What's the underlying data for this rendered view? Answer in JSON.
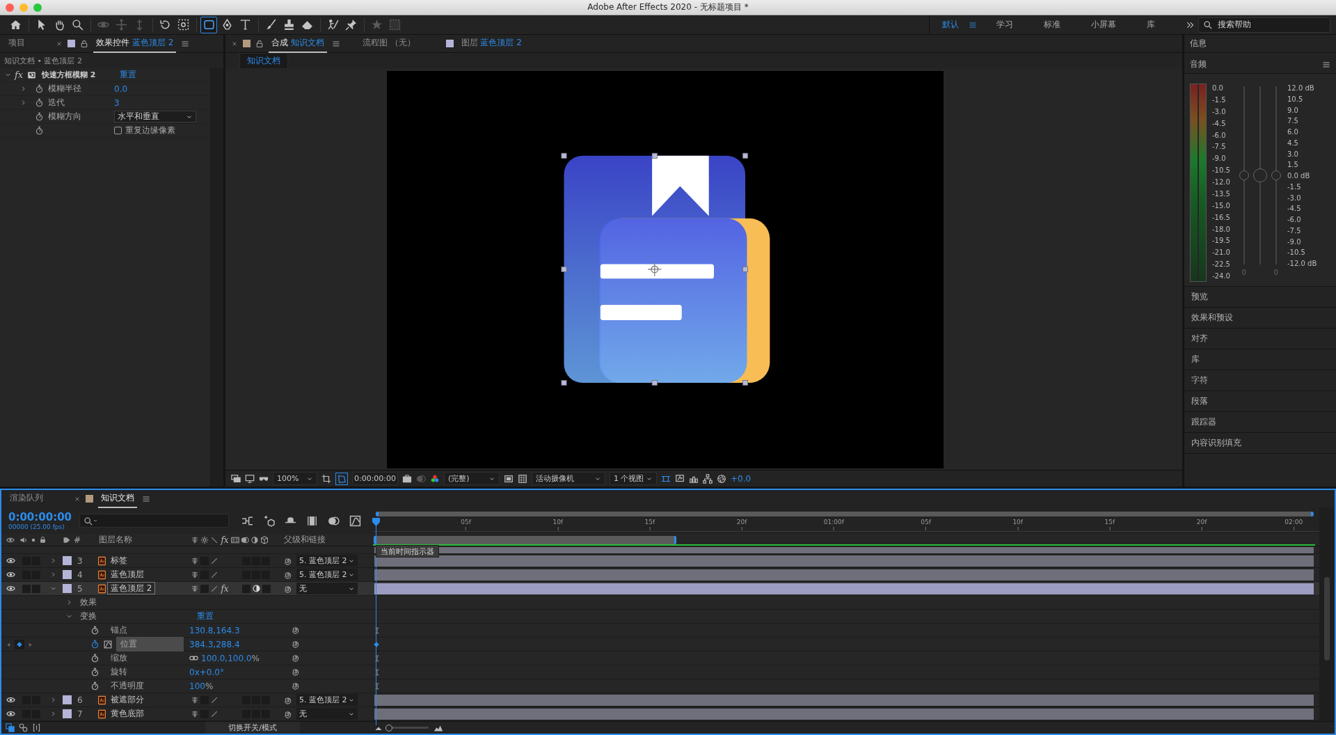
{
  "window": {
    "title": "Adobe After Effects 2020 - 无标题项目 *"
  },
  "toolbar": {
    "tools": [
      {
        "kind": "home",
        "selected": false,
        "disabled": false
      },
      {
        "kind": "select",
        "selected": false,
        "disabled": false
      },
      {
        "kind": "hand",
        "selected": false,
        "disabled": false
      },
      {
        "kind": "zoom",
        "selected": false,
        "disabled": false
      },
      {
        "kind": "orbit",
        "selected": false,
        "disabled": true
      },
      {
        "kind": "pan",
        "selected": false,
        "disabled": true
      },
      {
        "kind": "dolly",
        "selected": false,
        "disabled": true
      },
      {
        "kind": "rotate",
        "selected": false,
        "disabled": false
      },
      {
        "kind": "anchor",
        "selected": false,
        "disabled": false
      },
      {
        "kind": "rectangle",
        "selected": true,
        "disabled": false
      },
      {
        "kind": "pen",
        "selected": false,
        "disabled": false
      },
      {
        "kind": "type",
        "selected": false,
        "disabled": false
      },
      {
        "kind": "brush",
        "selected": false,
        "disabled": false
      },
      {
        "kind": "stamp",
        "selected": false,
        "disabled": false
      },
      {
        "kind": "eraser",
        "selected": false,
        "disabled": false
      },
      {
        "kind": "roto",
        "selected": false,
        "disabled": false
      },
      {
        "kind": "pin",
        "selected": false,
        "disabled": false
      },
      {
        "kind": "star",
        "selected": false,
        "disabled": true
      },
      {
        "kind": "snap",
        "selected": false,
        "disabled": true
      }
    ],
    "workspaces": [
      {
        "label": "默认",
        "selected": true
      },
      {
        "label": "学习",
        "selected": false
      },
      {
        "label": "标准",
        "selected": false
      },
      {
        "label": "小屏幕",
        "selected": false
      },
      {
        "label": "库",
        "selected": false
      }
    ],
    "search": {
      "placeholder": "搜索帮助"
    }
  },
  "effect_controls": {
    "tabs": [
      {
        "label": "项目",
        "selected": false
      },
      {
        "label": "效果控件",
        "target": "蓝色顶层 2",
        "color": "#b4b4d8",
        "selected": true
      }
    ],
    "breadcrumb": "知识文档 • 蓝色顶层 2",
    "effect": {
      "badge": "fx",
      "name": "快速方框模糊 2",
      "reset": "重置",
      "expanded": true,
      "properties": [
        {
          "kind": "value",
          "name": "模糊半径",
          "value": "0.0",
          "expanded": false
        },
        {
          "kind": "value",
          "name": "迭代",
          "value": "3",
          "expanded": false
        },
        {
          "kind": "dropdown",
          "name": "模糊方向",
          "value": "水平和垂直"
        },
        {
          "kind": "checkbox",
          "label": "重复边缘像素",
          "checked": false
        }
      ]
    }
  },
  "composition": {
    "tabs": [
      {
        "label": "合成",
        "target": "知识文档",
        "color": "#b39a7c",
        "selected": true
      },
      {
        "label": "流程图 （无）",
        "selected": false
      },
      {
        "label": "图层",
        "target": "蓝色顶层 2",
        "color": "#b4b4d8",
        "selected": false
      }
    ],
    "view_tab": "知识文档",
    "toolbar": {
      "zoom": "100%",
      "timecode": "0:00:00:00",
      "resolution": "(完整)",
      "camera": "活动摄像机",
      "views": "1 个视图",
      "exposure": "+0.0"
    }
  },
  "right_panel": {
    "info": "信息",
    "audio": {
      "title": "音频",
      "left_scale": [
        "0.0",
        "-1.5",
        "-3.0",
        "-4.5",
        "-6.0",
        "-7.5",
        "-9.0",
        "-10.5",
        "-12.0",
        "-13.5",
        "-15.0",
        "-16.5",
        "-18.0",
        "-19.5",
        "-21.0",
        "-22.5",
        "-24.0"
      ],
      "right_scale": [
        "12.0 dB",
        "10.5",
        "9.0",
        "7.5",
        "6.0",
        "4.5",
        "3.0",
        "1.5",
        "0.0 dB",
        "-1.5",
        "-3.0",
        "-4.5",
        "-6.0",
        "-7.5",
        "-9.0",
        "-10.5",
        "-12.0 dB"
      ],
      "faders": [
        {
          "level": 0.5,
          "reading": "0"
        },
        {
          "level": 0.5
        },
        {
          "level": 0.5,
          "reading": "0"
        }
      ]
    },
    "panels": [
      "预览",
      "效果和预设",
      "对齐",
      "库",
      "字符",
      "段落",
      "跟踪器",
      "内容识别填充"
    ]
  },
  "timeline": {
    "tabs": [
      {
        "label": "渲染队列",
        "selected": false
      },
      {
        "label": "知识文档",
        "color": "#b39a7c",
        "selected": true
      }
    ],
    "timecode": "0:00:00:00",
    "frame_info": "00000 (25.00 fps)",
    "columns": {
      "number": "#",
      "name": "图层名称",
      "effects": "fx",
      "parent": "父级和链接"
    },
    "ruler": [
      "05f",
      "10f",
      "15f",
      "20f",
      "01:00f",
      "05f",
      "10f",
      "15f",
      "20f",
      "02:00"
    ],
    "work_area": {
      "level": 0.32
    },
    "tooltip": "当前时间指示器",
    "layers": [
      {
        "number": "3",
        "name": "标签",
        "parent": "5. 蓝色顶层 2",
        "expanded": false,
        "selected": false,
        "adjustment": false
      },
      {
        "number": "4",
        "name": "蓝色顶层",
        "parent": "5. 蓝色顶层 2",
        "expanded": false,
        "selected": false,
        "adjustment": false
      },
      {
        "number": "5",
        "name": "蓝色顶层 2",
        "parent": "无",
        "effects_switch": "fx",
        "expanded": true,
        "selected": true,
        "adjustment": true,
        "groups": [
          {
            "label": "效果",
            "expanded": false
          },
          {
            "label": "变换",
            "expanded": true,
            "reset": "重置",
            "properties": [
              {
                "name": "锚点",
                "value": "130.8,164.3",
                "keyframed": false,
                "selected": false,
                "linked": false
              },
              {
                "name": "位置",
                "value": "384.3,288.4",
                "keyframed": true,
                "selected": true,
                "linked": false
              },
              {
                "name": "缩放",
                "value": "100.0,100.0",
                "unit": "%",
                "keyframed": false,
                "selected": false,
                "linked": true
              },
              {
                "name": "旋转",
                "value": "0x+0.0°",
                "keyframed": false,
                "selected": false,
                "linked": false
              },
              {
                "name": "不透明度",
                "value": "100",
                "unit": "%",
                "keyframed": false,
                "selected": false,
                "linked": false
              }
            ]
          }
        ]
      },
      {
        "number": "6",
        "name": "被遮部分",
        "parent": "5. 蓝色顶层 2",
        "expanded": false,
        "selected": false,
        "adjustment": false
      },
      {
        "number": "7",
        "name": "黄色底部",
        "parent": "无",
        "expanded": false,
        "selected": false,
        "adjustment": false
      }
    ],
    "mode_button": "切换开关/模式",
    "zoom_slider": {
      "level": 0.05
    }
  }
}
